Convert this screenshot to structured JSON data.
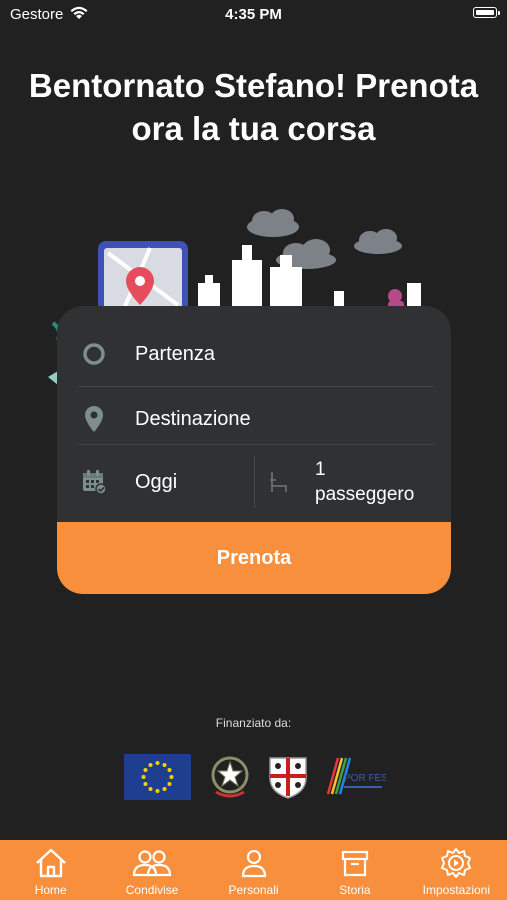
{
  "status_bar": {
    "carrier": "Gestore",
    "time": "4:35 PM"
  },
  "headline": "Bentornato Stefano! Prenota ora la tua corsa",
  "booking": {
    "departure_label": "Partenza",
    "destination_label": "Destinazione",
    "date_label": "Oggi",
    "passengers_count": "1",
    "passengers_label": "passeggero",
    "book_button": "Prenota"
  },
  "funding": {
    "label": "Finanziato da:"
  },
  "tab_bar": {
    "tabs": [
      {
        "label": "Home",
        "icon": "home-icon"
      },
      {
        "label": "Condivise",
        "icon": "group-icon"
      },
      {
        "label": "Personali",
        "icon": "person-icon"
      },
      {
        "label": "Storia",
        "icon": "archive-icon"
      },
      {
        "label": "Impostazioni",
        "icon": "settings-icon"
      }
    ]
  },
  "colors": {
    "accent": "#f78f3c",
    "background": "#212121",
    "card": "#2f3133"
  }
}
